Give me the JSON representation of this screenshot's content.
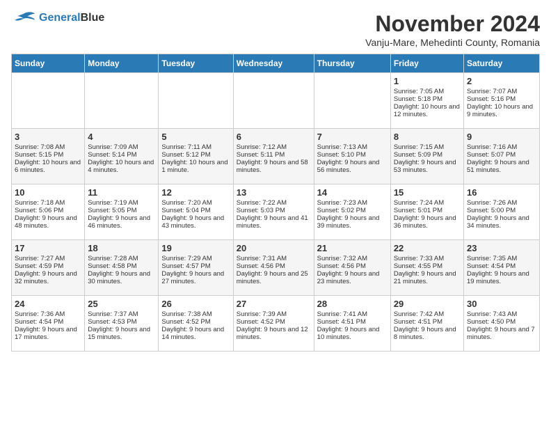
{
  "header": {
    "logo_line1": "General",
    "logo_line2": "Blue",
    "month": "November 2024",
    "location": "Vanju-Mare, Mehedinti County, Romania"
  },
  "days_of_week": [
    "Sunday",
    "Monday",
    "Tuesday",
    "Wednesday",
    "Thursday",
    "Friday",
    "Saturday"
  ],
  "weeks": [
    [
      {
        "day": "",
        "info": ""
      },
      {
        "day": "",
        "info": ""
      },
      {
        "day": "",
        "info": ""
      },
      {
        "day": "",
        "info": ""
      },
      {
        "day": "",
        "info": ""
      },
      {
        "day": "1",
        "info": "Sunrise: 7:05 AM\nSunset: 5:18 PM\nDaylight: 10 hours and 12 minutes."
      },
      {
        "day": "2",
        "info": "Sunrise: 7:07 AM\nSunset: 5:16 PM\nDaylight: 10 hours and 9 minutes."
      }
    ],
    [
      {
        "day": "3",
        "info": "Sunrise: 7:08 AM\nSunset: 5:15 PM\nDaylight: 10 hours and 6 minutes."
      },
      {
        "day": "4",
        "info": "Sunrise: 7:09 AM\nSunset: 5:14 PM\nDaylight: 10 hours and 4 minutes."
      },
      {
        "day": "5",
        "info": "Sunrise: 7:11 AM\nSunset: 5:12 PM\nDaylight: 10 hours and 1 minute."
      },
      {
        "day": "6",
        "info": "Sunrise: 7:12 AM\nSunset: 5:11 PM\nDaylight: 9 hours and 58 minutes."
      },
      {
        "day": "7",
        "info": "Sunrise: 7:13 AM\nSunset: 5:10 PM\nDaylight: 9 hours and 56 minutes."
      },
      {
        "day": "8",
        "info": "Sunrise: 7:15 AM\nSunset: 5:09 PM\nDaylight: 9 hours and 53 minutes."
      },
      {
        "day": "9",
        "info": "Sunrise: 7:16 AM\nSunset: 5:07 PM\nDaylight: 9 hours and 51 minutes."
      }
    ],
    [
      {
        "day": "10",
        "info": "Sunrise: 7:18 AM\nSunset: 5:06 PM\nDaylight: 9 hours and 48 minutes."
      },
      {
        "day": "11",
        "info": "Sunrise: 7:19 AM\nSunset: 5:05 PM\nDaylight: 9 hours and 46 minutes."
      },
      {
        "day": "12",
        "info": "Sunrise: 7:20 AM\nSunset: 5:04 PM\nDaylight: 9 hours and 43 minutes."
      },
      {
        "day": "13",
        "info": "Sunrise: 7:22 AM\nSunset: 5:03 PM\nDaylight: 9 hours and 41 minutes."
      },
      {
        "day": "14",
        "info": "Sunrise: 7:23 AM\nSunset: 5:02 PM\nDaylight: 9 hours and 39 minutes."
      },
      {
        "day": "15",
        "info": "Sunrise: 7:24 AM\nSunset: 5:01 PM\nDaylight: 9 hours and 36 minutes."
      },
      {
        "day": "16",
        "info": "Sunrise: 7:26 AM\nSunset: 5:00 PM\nDaylight: 9 hours and 34 minutes."
      }
    ],
    [
      {
        "day": "17",
        "info": "Sunrise: 7:27 AM\nSunset: 4:59 PM\nDaylight: 9 hours and 32 minutes."
      },
      {
        "day": "18",
        "info": "Sunrise: 7:28 AM\nSunset: 4:58 PM\nDaylight: 9 hours and 30 minutes."
      },
      {
        "day": "19",
        "info": "Sunrise: 7:29 AM\nSunset: 4:57 PM\nDaylight: 9 hours and 27 minutes."
      },
      {
        "day": "20",
        "info": "Sunrise: 7:31 AM\nSunset: 4:56 PM\nDaylight: 9 hours and 25 minutes."
      },
      {
        "day": "21",
        "info": "Sunrise: 7:32 AM\nSunset: 4:56 PM\nDaylight: 9 hours and 23 minutes."
      },
      {
        "day": "22",
        "info": "Sunrise: 7:33 AM\nSunset: 4:55 PM\nDaylight: 9 hours and 21 minutes."
      },
      {
        "day": "23",
        "info": "Sunrise: 7:35 AM\nSunset: 4:54 PM\nDaylight: 9 hours and 19 minutes."
      }
    ],
    [
      {
        "day": "24",
        "info": "Sunrise: 7:36 AM\nSunset: 4:54 PM\nDaylight: 9 hours and 17 minutes."
      },
      {
        "day": "25",
        "info": "Sunrise: 7:37 AM\nSunset: 4:53 PM\nDaylight: 9 hours and 15 minutes."
      },
      {
        "day": "26",
        "info": "Sunrise: 7:38 AM\nSunset: 4:52 PM\nDaylight: 9 hours and 14 minutes."
      },
      {
        "day": "27",
        "info": "Sunrise: 7:39 AM\nSunset: 4:52 PM\nDaylight: 9 hours and 12 minutes."
      },
      {
        "day": "28",
        "info": "Sunrise: 7:41 AM\nSunset: 4:51 PM\nDaylight: 9 hours and 10 minutes."
      },
      {
        "day": "29",
        "info": "Sunrise: 7:42 AM\nSunset: 4:51 PM\nDaylight: 9 hours and 8 minutes."
      },
      {
        "day": "30",
        "info": "Sunrise: 7:43 AM\nSunset: 4:50 PM\nDaylight: 9 hours and 7 minutes."
      }
    ]
  ]
}
